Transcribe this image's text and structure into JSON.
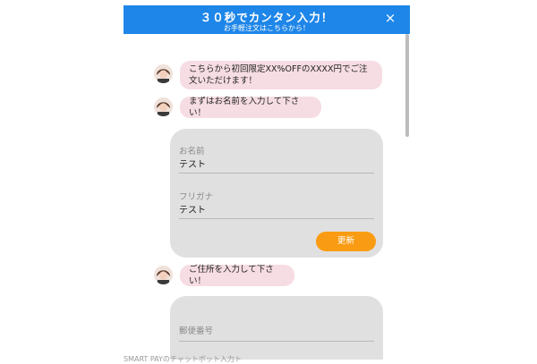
{
  "header": {
    "title": "３０秒でカンタン入力！",
    "subtitle": "お手軽注文はこちらから！",
    "close_icon": "×"
  },
  "messages": [
    {
      "text": "こちらから初回限定XX%OFFのXXXX円でご注文いただけます！"
    },
    {
      "text": "まずはお名前を入力して下さい！"
    },
    {
      "text": "ご住所を入力して下さい！"
    }
  ],
  "name_form": {
    "name_label": "お名前",
    "name_value": "テスト",
    "kana_label": "フリガナ",
    "kana_value": "テスト",
    "update_button": "更新"
  },
  "address_form": {
    "postal_label": "郵便番号"
  },
  "footer_cutoff": "SMART PAYのチャットボット入力ト"
}
